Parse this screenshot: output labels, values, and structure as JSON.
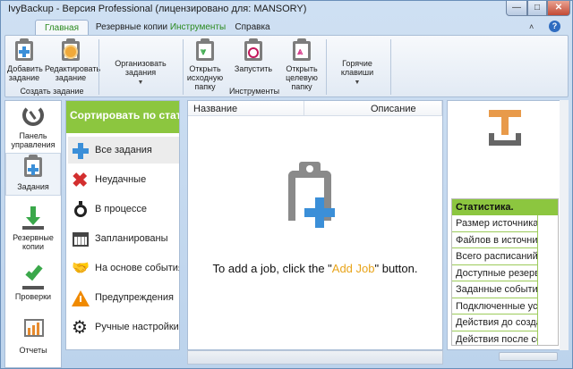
{
  "window": {
    "title": "IvyBackup - Версия Professional (лицензировано для: MANSORY)",
    "buttons": {
      "minimize": "—",
      "maximize": "□",
      "close": "✕"
    }
  },
  "tabs": [
    {
      "label": "Главная",
      "active": true
    },
    {
      "label": "Резервные копии"
    },
    {
      "label": "Инструменты"
    },
    {
      "label": "Справка"
    }
  ],
  "ribbon": {
    "create_group": {
      "label": "Создать задание",
      "add": "Добавить задание",
      "edit": "Редактировать задание"
    },
    "organize": {
      "label": "Организовать задания"
    },
    "tools_group": {
      "label": "Инструменты",
      "open_source": "Открыть исходную папку",
      "run": "Запустить",
      "open_target": "Открыть целевую папку"
    },
    "hotkeys": {
      "label": "Горячие клавиши"
    },
    "help": "?"
  },
  "leftnav": {
    "dashboard": "Панель управления",
    "jobs": "Задания",
    "backups": "Резервные копии",
    "checks": "Проверки",
    "reports": "Отчеты"
  },
  "filter": {
    "header": "Сортировать по статусу",
    "items": [
      {
        "label": "Все задания",
        "icon": "plus-icon"
      },
      {
        "label": "Неудачные",
        "icon": "x-icon"
      },
      {
        "label": "В процессе",
        "icon": "stopwatch-icon"
      },
      {
        "label": "Запланированы",
        "icon": "calendar-icon"
      },
      {
        "label": "На основе события",
        "icon": "handshake-icon"
      },
      {
        "label": "Предупреждения",
        "icon": "warning-icon"
      },
      {
        "label": "Ручные настройки",
        "icon": "gear-icon"
      }
    ]
  },
  "jobs_list": {
    "columns": {
      "name": "Название",
      "description": "Описание"
    },
    "empty": {
      "before": "To add a job, click the \"",
      "link": "Add Job",
      "after": "\" button."
    }
  },
  "stats": {
    "header": "Статистика.",
    "rows": [
      "Размер источника",
      "Файлов в источнике",
      "Всего расписаний",
      "Доступные резервные",
      "Заданные события",
      "Подключенные устройства",
      "Действия до создания",
      "Действия после создания"
    ]
  },
  "colors": {
    "accent_green": "#8cc63f",
    "link_orange": "#e8a41a",
    "icon_blue": "#3b8fd8"
  }
}
